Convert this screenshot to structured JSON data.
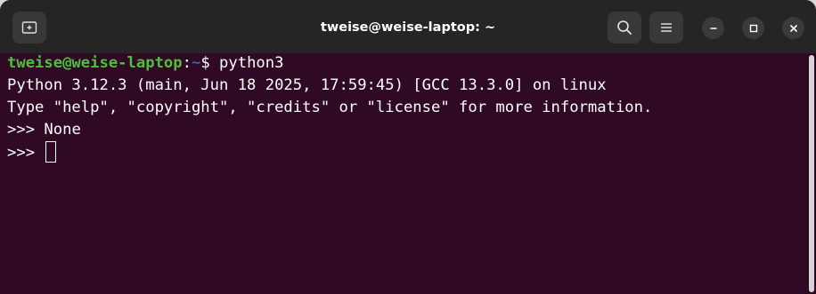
{
  "window": {
    "title": "tweise@weise-laptop: ~"
  },
  "titlebar": {
    "new_tab_icon": "new-tab-icon",
    "search_icon": "search-icon",
    "menu_icon": "hamburger-menu-icon",
    "minimize_icon": "minimize-icon",
    "maximize_icon": "maximize-icon",
    "close_icon": "close-icon"
  },
  "terminal": {
    "prompt_user": "tweise@weise-laptop",
    "prompt_sep": ":",
    "prompt_path": "~",
    "prompt_dollar": "$ ",
    "command": "python3",
    "line2": "Python 3.12.3 (main, Jun 18 2025, 17:59:45) [GCC 13.3.0] on linux",
    "line3": "Type \"help\", \"copyright\", \"credits\" or \"license\" for more information.",
    "line4_prompt": ">>> ",
    "line4_output": "None",
    "line5_prompt": ">>> "
  },
  "colors": {
    "terminal_bg": "#300a24",
    "titlebar_bg": "#252525",
    "user_green": "#4ebf3d",
    "path_blue": "#3465a4"
  }
}
